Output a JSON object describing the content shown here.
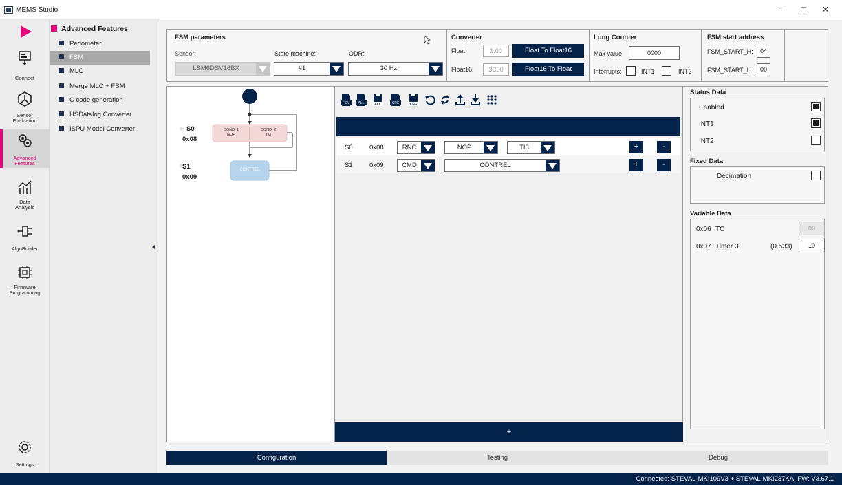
{
  "window": {
    "title": "MEMS Studio",
    "min": "–",
    "max": "□",
    "close": "✕"
  },
  "leftnav": {
    "items": [
      {
        "label": "Connect"
      },
      {
        "label": "Sensor\nEvaluation"
      },
      {
        "label": "Advanced\nFeatures"
      },
      {
        "label": "Data\nAnalysis"
      },
      {
        "label": "AlgoBuilder"
      },
      {
        "label": "Firmware\nProgramming"
      },
      {
        "label": "Settings"
      }
    ]
  },
  "features": {
    "title": "Advanced Features",
    "items": [
      "Pedometer",
      "FSM",
      "MLC",
      "Merge MLC + FSM",
      "C code generation",
      "HSDatalog Converter",
      "ISPU Model Converter"
    ],
    "selected": "FSM"
  },
  "fsm_params": {
    "title": "FSM parameters",
    "sensor_label": "Sensor:",
    "sensor_value": "LSM6DSV16BX",
    "state_machine_label": "State machine:",
    "state_machine_value": "#1",
    "odr_label": "ODR:",
    "odr_value": "30 Hz"
  },
  "converter": {
    "title": "Converter",
    "float_label": "Float:",
    "float_value": "1.00",
    "float_btn": "Float To Float16",
    "float16_label": "Float16:",
    "float16_value": "3C00",
    "float16_btn": "Float16 To Float"
  },
  "long_counter": {
    "title": "Long Counter",
    "max_label": "Max value",
    "max_value": "0000",
    "interrupts_label": "Interrupts:",
    "int1": "INT1",
    "int2": "INT2"
  },
  "start_address": {
    "title": "FSM start address",
    "h_label": "FSM_START_H:",
    "h_value": "04",
    "l_label": "FSM_START_L:",
    "l_value": "00"
  },
  "graph": {
    "s0_name": "S0",
    "s0_addr": "0x08",
    "s1_name": "S1",
    "s1_addr": "0x09",
    "cond1_title": "COND_1",
    "cond1_value": "NOP",
    "cond2_title": "COND_2",
    "cond2_value": "TI3",
    "contrel": "CONTREL"
  },
  "toolbar": {
    "icons": [
      "save-fsm-icon",
      "save-all-icon",
      "save-all-disk-icon",
      "load-cfg-icon",
      "save-cfg-icon",
      "undo-icon",
      "refresh-icon",
      "upload-icon",
      "download-icon",
      "grid-icon"
    ],
    "badges": [
      "FSM",
      "ALL",
      "ALL",
      "CFG",
      "CFG"
    ]
  },
  "table": {
    "rows": [
      {
        "state": "S0",
        "addr": "0x08",
        "cmd": "RNC",
        "cond1": "NOP",
        "cond2": "TI3"
      },
      {
        "state": "S1",
        "addr": "0x09",
        "cmd": "CMD",
        "cond1": "CONTREL"
      }
    ],
    "plus": "+",
    "minus": "-",
    "add": "+"
  },
  "status_data": {
    "title": "Status Data",
    "items": [
      {
        "label": "Enabled",
        "checked": true
      },
      {
        "label": "INT1",
        "checked": true
      },
      {
        "label": "INT2",
        "checked": false
      }
    ]
  },
  "fixed_data": {
    "title": "Fixed Data",
    "decimation_label": "Decimation"
  },
  "variable_data": {
    "title": "Variable Data",
    "rows": [
      {
        "addr": "0x06",
        "name": "TC",
        "extra": "",
        "value": "00"
      },
      {
        "addr": "0x07",
        "name": "Timer 3",
        "extra": "(0.533)",
        "value": "10"
      }
    ]
  },
  "tabs": [
    "Configuration",
    "Testing",
    "Debug"
  ],
  "active_tab": "Configuration",
  "statusbar": "Connected:  STEVAL-MKI109V3 + STEVAL-MKI237KA, FW: V3.67.1",
  "colors": {
    "navy": "#03234b",
    "magenta": "#e6007e"
  }
}
